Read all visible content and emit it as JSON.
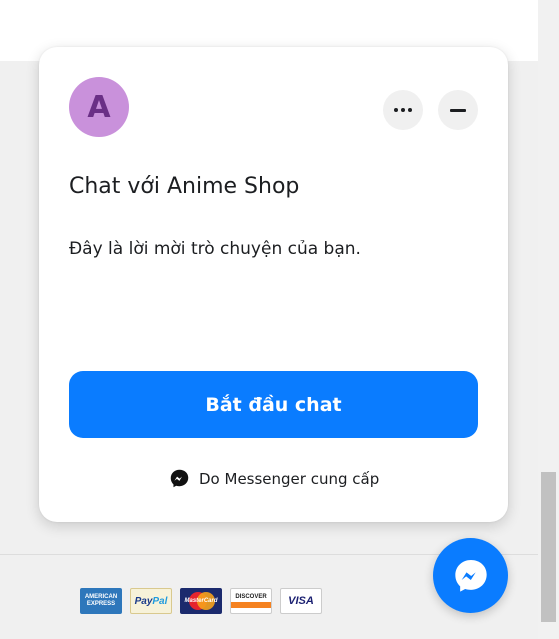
{
  "chat_widget": {
    "avatar_letter": "A",
    "title": "Chat với Anime Shop",
    "greeting": "Đây là lời mời trò chuyện của bạn.",
    "start_button_label": "Bắt đầu chat",
    "powered_by": "Do Messenger cung cấp",
    "more_options_icon": "ellipsis-icon",
    "minimize_icon": "minus-icon",
    "accent_color": "#0a7cff",
    "avatar_color": "#c991db"
  },
  "messenger_fab": {
    "icon": "messenger-icon"
  },
  "footer": {
    "payment_methods": {
      "amex_line1": "AMERICAN",
      "amex_line2": "EXPRESS",
      "paypal_pay": "Pay",
      "paypal_pal": "Pal",
      "mastercard": "MasterCard",
      "discover": "DISCOVER",
      "visa": "VISA"
    }
  }
}
